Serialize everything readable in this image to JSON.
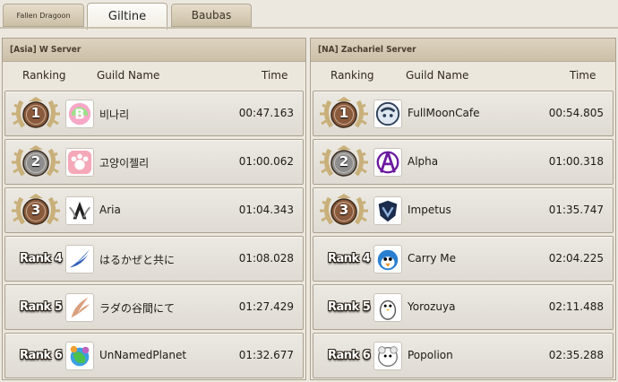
{
  "tabs": [
    {
      "label": "Fallen Dragoon",
      "active": false
    },
    {
      "label": "Giltine",
      "active": true
    },
    {
      "label": "Baubas",
      "active": false
    }
  ],
  "columns": {
    "ranking": "Ranking",
    "guild": "Guild Name",
    "time": "Time"
  },
  "panels": [
    {
      "title": "[Asia] W Server",
      "rows": [
        {
          "rank": "1",
          "guild": "비나리",
          "time": "00:47.163",
          "medal": "bronze"
        },
        {
          "rank": "2",
          "guild": "고양이젤리",
          "time": "01:00.062",
          "medal": "silver"
        },
        {
          "rank": "3",
          "guild": "Aria",
          "time": "01:04.343",
          "medal": "bronze"
        },
        {
          "rank": "Rank 4",
          "guild": "はるかぜと共に",
          "time": "01:08.028"
        },
        {
          "rank": "Rank 5",
          "guild": "ラダの谷間にて",
          "time": "01:27.429"
        },
        {
          "rank": "Rank 6",
          "guild": "UnNamedPlanet",
          "time": "01:32.677"
        }
      ]
    },
    {
      "title": "[NA] Zachariel Server",
      "rows": [
        {
          "rank": "1",
          "guild": "FullMoonCafe",
          "time": "00:54.805",
          "medal": "bronze"
        },
        {
          "rank": "2",
          "guild": "Alpha",
          "time": "01:00.318",
          "medal": "silver"
        },
        {
          "rank": "3",
          "guild": "Impetus",
          "time": "01:35.747",
          "medal": "bronze"
        },
        {
          "rank": "Rank 4",
          "guild": "Carry Me",
          "time": "02:04.225"
        },
        {
          "rank": "Rank 5",
          "guild": "Yorozuya",
          "time": "02:11.488"
        },
        {
          "rank": "Rank 6",
          "guild": "Popolion",
          "time": "02:35.288"
        }
      ]
    }
  ],
  "colors": {
    "bronze": "#8a5a3c",
    "silver": "#8e8e8e",
    "wreath": "#c9b07a"
  }
}
